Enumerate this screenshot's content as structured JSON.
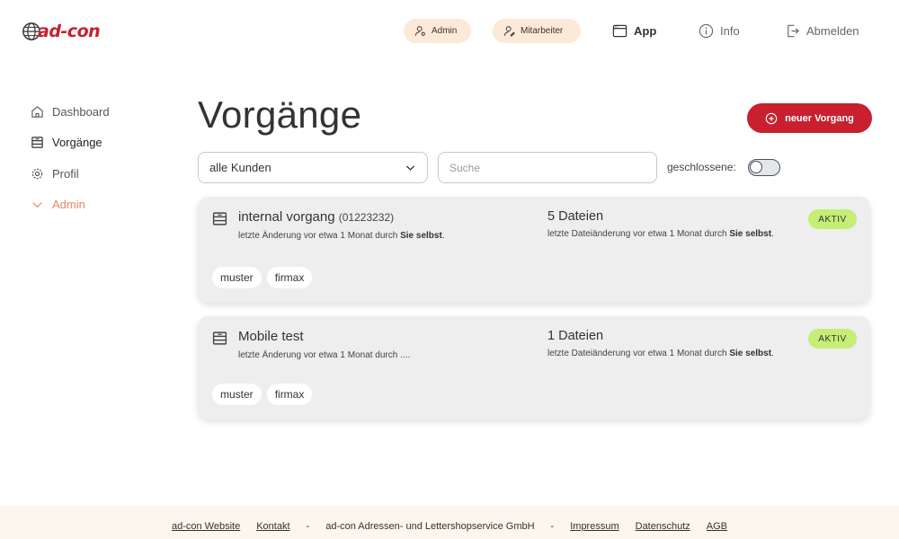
{
  "header": {
    "logo_text": "ad-con",
    "admin_label": "Admin",
    "mitarbeiter_label": "Mitarbeiter",
    "app_label": "App",
    "info_label": "Info",
    "logout_label": "Abmelden",
    "pill_color": "#fde9d8"
  },
  "sidebar": {
    "items": [
      {
        "label": "Dashboard",
        "icon": "home-icon"
      },
      {
        "label": "Vorgänge",
        "icon": "archive-icon"
      },
      {
        "label": "Profil",
        "icon": "gear-icon"
      },
      {
        "label": "Admin",
        "icon": "chevron-down-icon"
      }
    ]
  },
  "main": {
    "title": "Vorgänge",
    "new_button_label": "neuer Vorgang",
    "customer_filter_value": "alle Kunden",
    "search_placeholder": "Suche",
    "closed_label": "geschlossene:",
    "accent_color": "#c8202f",
    "active_color": "#c6ed76"
  },
  "cards": [
    {
      "title": "internal vorgang",
      "number": "(01223232)",
      "sub_prefix": "letzte Änderung vor etwa 1 Monat durch ",
      "sub_by": "Sie selbst",
      "sub_suffix": ".",
      "files": "5 Dateien",
      "files_prefix": "letzte Dateiänderung vor etwa 1 Monat durch ",
      "files_by": "Sie selbst",
      "files_suffix": ".",
      "badge": "AKTIV",
      "tags": [
        "muster",
        "firmax"
      ]
    },
    {
      "title": "Mobile test",
      "sub_text": "letzte Änderung vor etwa 1 Monat durch ....",
      "files": "1 Dateien",
      "files_prefix": "letzte Dateiänderung vor etwa 1 Monat durch ",
      "files_by": "Sie selbst",
      "files_suffix": ".",
      "badge": "AKTIV",
      "tags": [
        "muster",
        "firmax"
      ]
    }
  ],
  "footer": {
    "website": "ad-con Website",
    "contact": "Kontakt",
    "sep1": "-",
    "company": "ad-con Adressen- und Lettershopservice GmbH",
    "sep2": "-",
    "imprint": "Impressum",
    "privacy": "Datenschutz",
    "terms": "AGB"
  }
}
